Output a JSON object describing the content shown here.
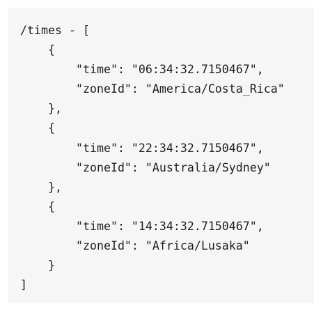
{
  "code": {
    "lines": [
      "/times - [",
      "{",
      "\"time\": \"06:34:32.7150467\",",
      "\"zoneId\": \"America/Costa_Rica\"",
      "},",
      "{",
      "\"time\": \"22:34:32.7150467\",",
      "\"zoneId\": \"Australia/Sydney\"",
      "},",
      "{",
      "\"time\": \"14:34:32.7150467\",",
      "\"zoneId\": \"Africa/Lusaka\"",
      "}",
      "]"
    ]
  }
}
